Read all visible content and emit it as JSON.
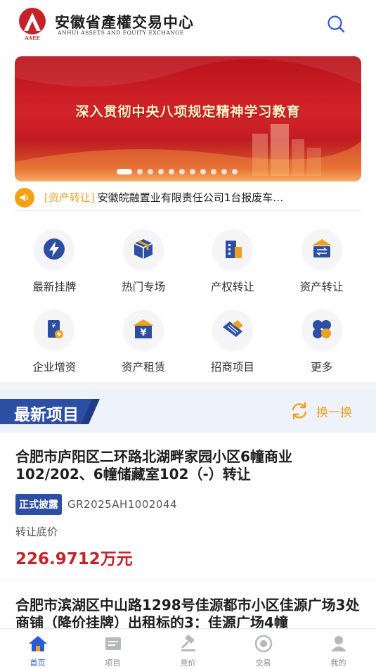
{
  "header": {
    "logo_cn": "安徽省產權交易中心",
    "logo_en": "ANHUI ASSETS AND EQUITY EXCHANGE",
    "logo_abbr": "AAEE"
  },
  "banner": {
    "title": "深入贯彻中央八项规定精神学习教育",
    "slide_count": 11,
    "active_index": 0
  },
  "notice": {
    "tag": "[资产转让]",
    "text": "安徽皖融置业有限责任公司1台报废车…"
  },
  "categories": [
    {
      "label": "最新挂牌",
      "icon": "lightning-icon"
    },
    {
      "label": "热门专场",
      "icon": "box-icon"
    },
    {
      "label": "产权转让",
      "icon": "building-icon"
    },
    {
      "label": "资产转让",
      "icon": "transfer-icon"
    },
    {
      "label": "企业增资",
      "icon": "capital-increase-icon"
    },
    {
      "label": "资产租赁",
      "icon": "lease-icon"
    },
    {
      "label": "招商项目",
      "icon": "handshake-icon"
    },
    {
      "label": "更多",
      "icon": "more-icon"
    }
  ],
  "section": {
    "title": "最新项目",
    "refresh_label": "换一换"
  },
  "projects": [
    {
      "title": "合肥市庐阳区二环路北湖畔家园小区6幢商业102/202、6幢储藏室102（-）转让",
      "tag": "正式披露",
      "code": "GR2025AH1002044",
      "price_label": "转让底价",
      "price": "226.9712万元"
    },
    {
      "title": "合肥市滨湖区中山路1298号佳源都市小区佳源广场3处商铺（降价挂牌）出租标的3：佳源广场4幢"
    }
  ],
  "tabbar": [
    {
      "label": "首页",
      "icon": "home-icon",
      "active": true
    },
    {
      "label": "项目",
      "icon": "project-icon",
      "active": false
    },
    {
      "label": "竞价",
      "icon": "auction-icon",
      "active": false
    },
    {
      "label": "交易",
      "icon": "trade-icon",
      "active": false
    },
    {
      "label": "我的",
      "icon": "user-icon",
      "active": false
    }
  ],
  "colors": {
    "brand_blue": "#2c4fa3",
    "accent_orange": "#f0a020",
    "price_red": "#c4232a",
    "active_tab": "#2c5bd6"
  }
}
